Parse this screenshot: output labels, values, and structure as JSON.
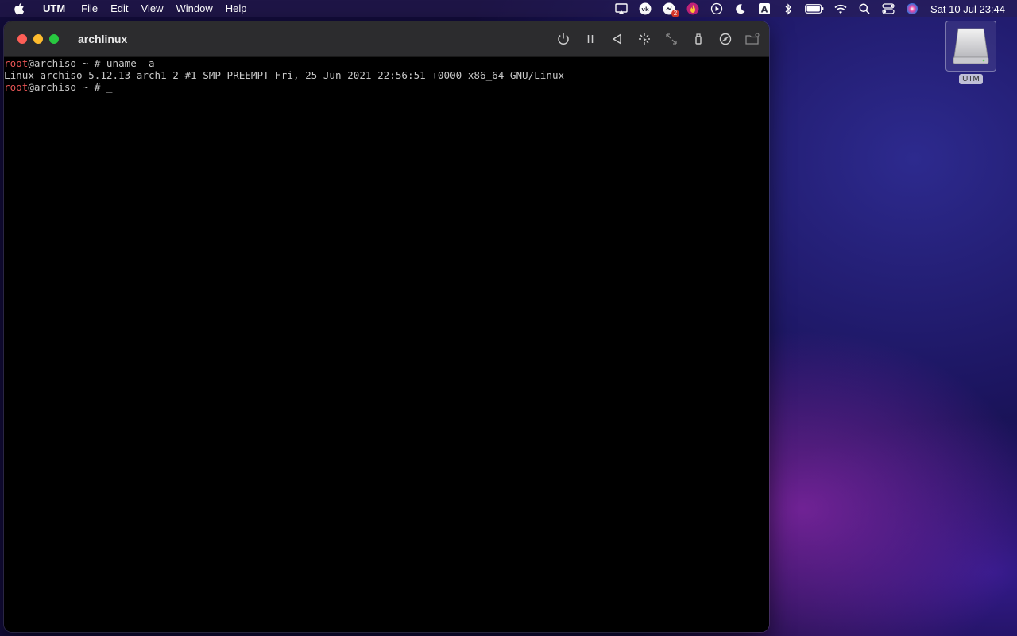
{
  "menubar": {
    "app_name": "UTM",
    "items": [
      "File",
      "Edit",
      "View",
      "Window",
      "Help"
    ],
    "clock": "Sat 10 Jul  23:44",
    "notification_badge": "2"
  },
  "window": {
    "title": "archlinux"
  },
  "terminal": {
    "lines": [
      {
        "user": "root",
        "rest": "@archiso ~ # uname -a"
      },
      {
        "text": "Linux archiso 5.12.13-arch1-2 #1 SMP PREEMPT Fri, 25 Jun 2021 22:56:51 +0000 x86_64 GNU/Linux"
      },
      {
        "user": "root",
        "rest": "@archiso ~ # ",
        "cursor": "_"
      }
    ]
  },
  "desktop": {
    "icon_label": "UTM"
  },
  "colors": {
    "prompt_user": "#e85555",
    "terminal_text": "#c8c8c8"
  }
}
